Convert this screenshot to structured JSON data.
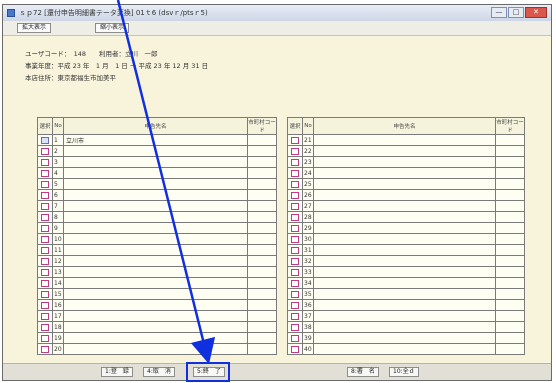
{
  "window": {
    "title": "ｓｐ72 [還付申告明細書テータ変換] 01ｔ6 (dsvｒ/ptsｒ5)",
    "buttons": [
      "—",
      "□",
      "✕"
    ]
  },
  "toolbar": {
    "expand_label": "拡大表示",
    "shrink_label": "縮小表示"
  },
  "info": {
    "line1": "ユーザコード：　148　　利用者：立川　一郎",
    "line2": "事業年度：平成 23 年　1 月　1 日 ～ 平成 23 年 12 月 31 日",
    "line3": "本店住所：東京都福生市加美平"
  },
  "table": {
    "headers": {
      "sel": "選択",
      "no": "No",
      "name": "申告先名",
      "code": "市町村コード"
    },
    "left_rows": [
      {
        "no": "1",
        "name": "立川市",
        "checked": true
      },
      {
        "no": "2",
        "name": ""
      },
      {
        "no": "3",
        "name": ""
      },
      {
        "no": "4",
        "name": ""
      },
      {
        "no": "5",
        "name": ""
      },
      {
        "no": "6",
        "name": ""
      },
      {
        "no": "7",
        "name": ""
      },
      {
        "no": "8",
        "name": ""
      },
      {
        "no": "9",
        "name": ""
      },
      {
        "no": "10",
        "name": ""
      },
      {
        "no": "11",
        "name": ""
      },
      {
        "no": "12",
        "name": ""
      },
      {
        "no": "13",
        "name": ""
      },
      {
        "no": "14",
        "name": ""
      },
      {
        "no": "15",
        "name": ""
      },
      {
        "no": "16",
        "name": ""
      },
      {
        "no": "17",
        "name": ""
      },
      {
        "no": "18",
        "name": ""
      },
      {
        "no": "19",
        "name": ""
      },
      {
        "no": "20",
        "name": ""
      }
    ],
    "right_rows": [
      {
        "no": "21",
        "name": ""
      },
      {
        "no": "22",
        "name": ""
      },
      {
        "no": "23",
        "name": ""
      },
      {
        "no": "24",
        "name": ""
      },
      {
        "no": "25",
        "name": ""
      },
      {
        "no": "26",
        "name": ""
      },
      {
        "no": "27",
        "name": ""
      },
      {
        "no": "28",
        "name": ""
      },
      {
        "no": "29",
        "name": ""
      },
      {
        "no": "30",
        "name": ""
      },
      {
        "no": "31",
        "name": ""
      },
      {
        "no": "32",
        "name": ""
      },
      {
        "no": "33",
        "name": ""
      },
      {
        "no": "34",
        "name": ""
      },
      {
        "no": "35",
        "name": ""
      },
      {
        "no": "36",
        "name": ""
      },
      {
        "no": "37",
        "name": ""
      },
      {
        "no": "38",
        "name": ""
      },
      {
        "no": "39",
        "name": ""
      },
      {
        "no": "40",
        "name": ""
      }
    ]
  },
  "footer": {
    "register_label": "1:登　録",
    "cancel_label": "4:取　消",
    "finish_label": "5:終　了",
    "print_label": "8:署　名",
    "select_all_label": "10:全ｄ"
  },
  "colors": {
    "annotation": "#1030e0",
    "background": "#f8f4dc"
  }
}
